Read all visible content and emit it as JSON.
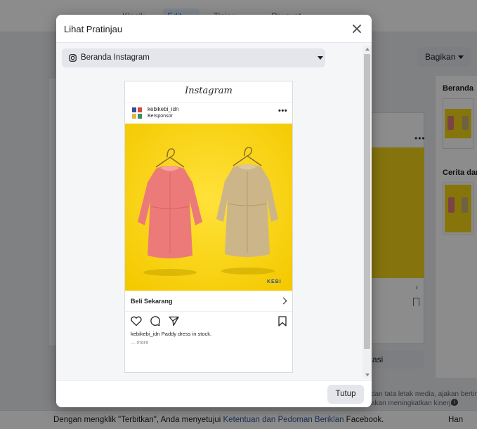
{
  "background": {
    "tabs": [
      "Klasik",
      "Edit",
      "Tinjau",
      "Riwayat"
    ],
    "share_button": "Bagikan",
    "side_sections": [
      "Beranda",
      "Cerita dan"
    ],
    "promo_button": "asi",
    "info_text_1": "dan tata letak media, ajakan bertindak",
    "info_text_2": "akan meningkatkan kinerja.",
    "footer": {
      "prefix": "Dengan mengklik \"Terbitkan\", Anda menyetujui ",
      "link": "Ketentuan dan Pedoman Beriklan",
      "suffix": " Facebook.",
      "right": "Han"
    }
  },
  "modal": {
    "title": "Lihat Pratinjau",
    "placement": {
      "label": "Beranda Instagram",
      "icon": "instagram-icon"
    },
    "close_label": "Tutup"
  },
  "instagram_post": {
    "logo": "Instagram",
    "username": "kebikebi_idn",
    "sponsored": "Bersponsor",
    "cta": "Beli Sekarang",
    "caption_user": "kebikebi_idn",
    "caption_text": " Paddy dress in stock.",
    "more": "... more",
    "brand_mark": "KEBI",
    "image_background": "#f8d507",
    "dress_colors": [
      "#ec7a78",
      "#cdb58a"
    ]
  },
  "colors": {
    "link": "#385898",
    "accent": "#1877f2",
    "button_gray": "#e4e6eb"
  }
}
